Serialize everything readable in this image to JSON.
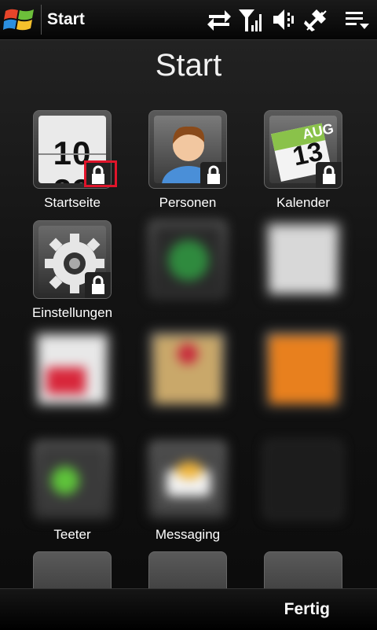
{
  "statusbar": {
    "title": "Start",
    "icons": [
      "windows-logo-icon",
      "sync-icon",
      "signal-icon",
      "volume-icon",
      "connection-icon",
      "menu-icon"
    ]
  },
  "page": {
    "title": "Start"
  },
  "tiles": [
    {
      "label": "Startseite",
      "clock": "10 23",
      "locked": true,
      "highlighted": true
    },
    {
      "label": "Personen",
      "locked": true
    },
    {
      "label": "Kalender",
      "calendar_month": "AUG",
      "calendar_day": "13",
      "locked": true
    },
    {
      "label": "Einstellungen",
      "locked": true
    },
    {
      "label": "Teeter"
    },
    {
      "label": "Messaging"
    }
  ],
  "colors": {
    "highlight": "#e0142a",
    "background": "#0b0b0b"
  },
  "bottombar": {
    "done_label": "Fertig"
  }
}
